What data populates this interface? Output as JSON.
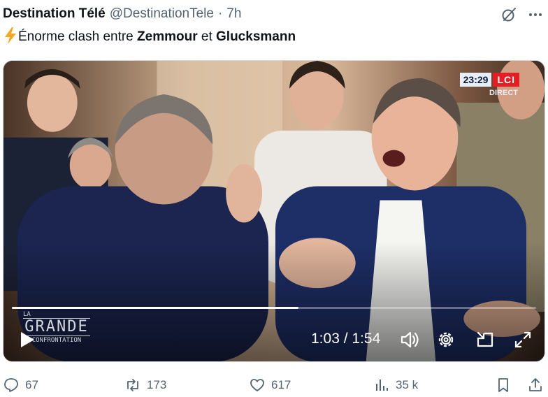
{
  "tweet": {
    "author": "Destination Télé",
    "handle": "@DestinationTele",
    "separator": "·",
    "time": "7h",
    "text_prefix": "Énorme clash entre ",
    "name1": "Zemmour",
    "text_middle": " et ",
    "name2": "Glucksmann"
  },
  "video": {
    "broadcast_time": "23:29",
    "channel": "LCI",
    "live_label": "DIRECT",
    "show_small": "LA",
    "show_title": "GRANDE",
    "show_subtitle": "CONFRONTATION",
    "timecode": "1:03 / 1:54",
    "progress": 0.547
  },
  "actions": {
    "replies": "67",
    "reposts": "173",
    "likes": "617",
    "views": "35 k"
  },
  "colors": {
    "text": "#0f1419",
    "muted": "#536471",
    "lci_red": "#e31e24",
    "bolt": "#f5a623"
  },
  "icons": [
    "grok-icon",
    "more-icon",
    "lightning-icon",
    "play-icon",
    "volume-icon",
    "settings-icon",
    "pip-icon",
    "fullscreen-icon",
    "reply-icon",
    "repost-icon",
    "like-icon",
    "views-icon",
    "bookmark-icon",
    "share-icon"
  ]
}
